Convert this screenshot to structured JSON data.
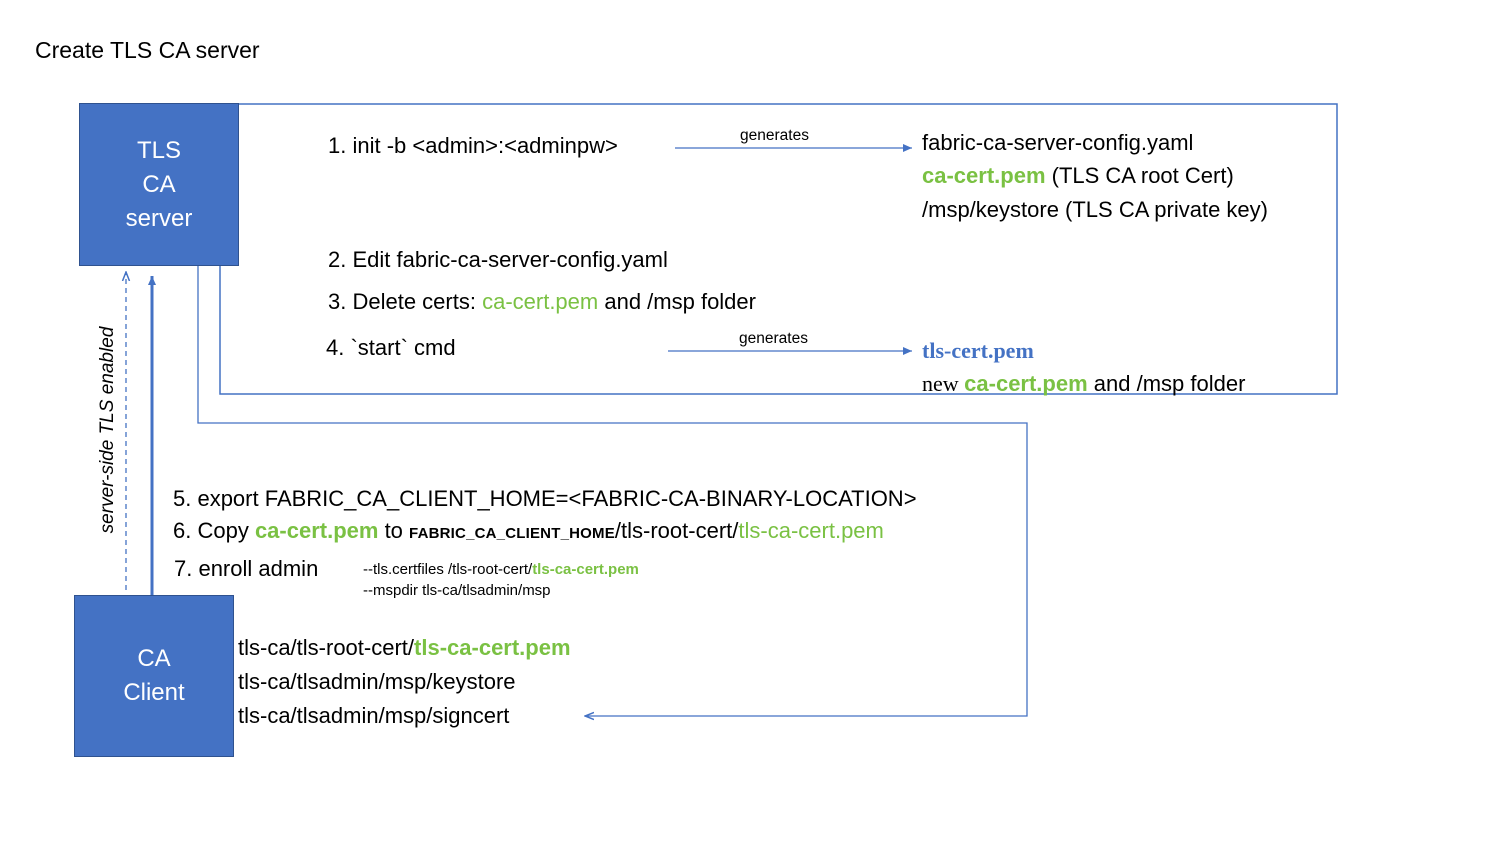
{
  "title": "Create TLS CA server",
  "boxes": {
    "tls_server": {
      "line1": "TLS",
      "line2": "CA",
      "line3": "server"
    },
    "ca_client": {
      "line1": "CA",
      "line2": "Client"
    }
  },
  "vertical_label": "server-side TLS enabled",
  "edge_labels": {
    "generates_1": "generates",
    "generates_2": "generates"
  },
  "steps": {
    "s1": "1. init -b <admin>:<adminpw>",
    "s2": "2. Edit fabric-ca-server-config.yaml",
    "s3_pre": "3. Delete certs: ",
    "s3_green": "ca-cert.pem",
    "s3_post": " and /msp folder",
    "s4": "4. `start` cmd",
    "s5": "5. export FABRIC_CA_CLIENT_HOME=<FABRIC-CA-BINARY-LOCATION>",
    "s6_pre": "6. Copy ",
    "s6_green": "ca-cert.pem",
    "s6_mid": " to ",
    "s6_env": "FABRIC_CA_CLIENT_HOME",
    "s6_path": "/tls-root-cert/",
    "s6_green2": "tls-ca-cert.pem",
    "s7": "7. enroll admin",
    "s7_flag1_pre": "--tls.certfiles /tls-root-cert/",
    "s7_flag1_green": "tls-ca-cert.pem",
    "s7_flag2": "--mspdir tls-ca/tlsadmin/msp"
  },
  "outputs1": {
    "line1": "fabric-ca-server-config.yaml",
    "line2_green": "ca-cert.pem",
    "line2_rest": " (TLS CA root Cert)",
    "line3": "/msp/keystore (TLS CA private key)"
  },
  "outputs2": {
    "line1": "tls-cert.pem",
    "line2_pre": "new ",
    "line2_green": "ca-cert.pem",
    "line2_post": " and /msp folder"
  },
  "client_files": {
    "line1_pre": "tls-ca/tls-root-cert/",
    "line1_green": "tls-ca-cert.pem",
    "line2": "tls-ca/tlsadmin/msp/keystore",
    "line3": "tls-ca/tlsadmin/msp/signcert"
  },
  "colors": {
    "box": "#4472c4",
    "accent_green": "#7ac143",
    "line": "#4472c4"
  }
}
